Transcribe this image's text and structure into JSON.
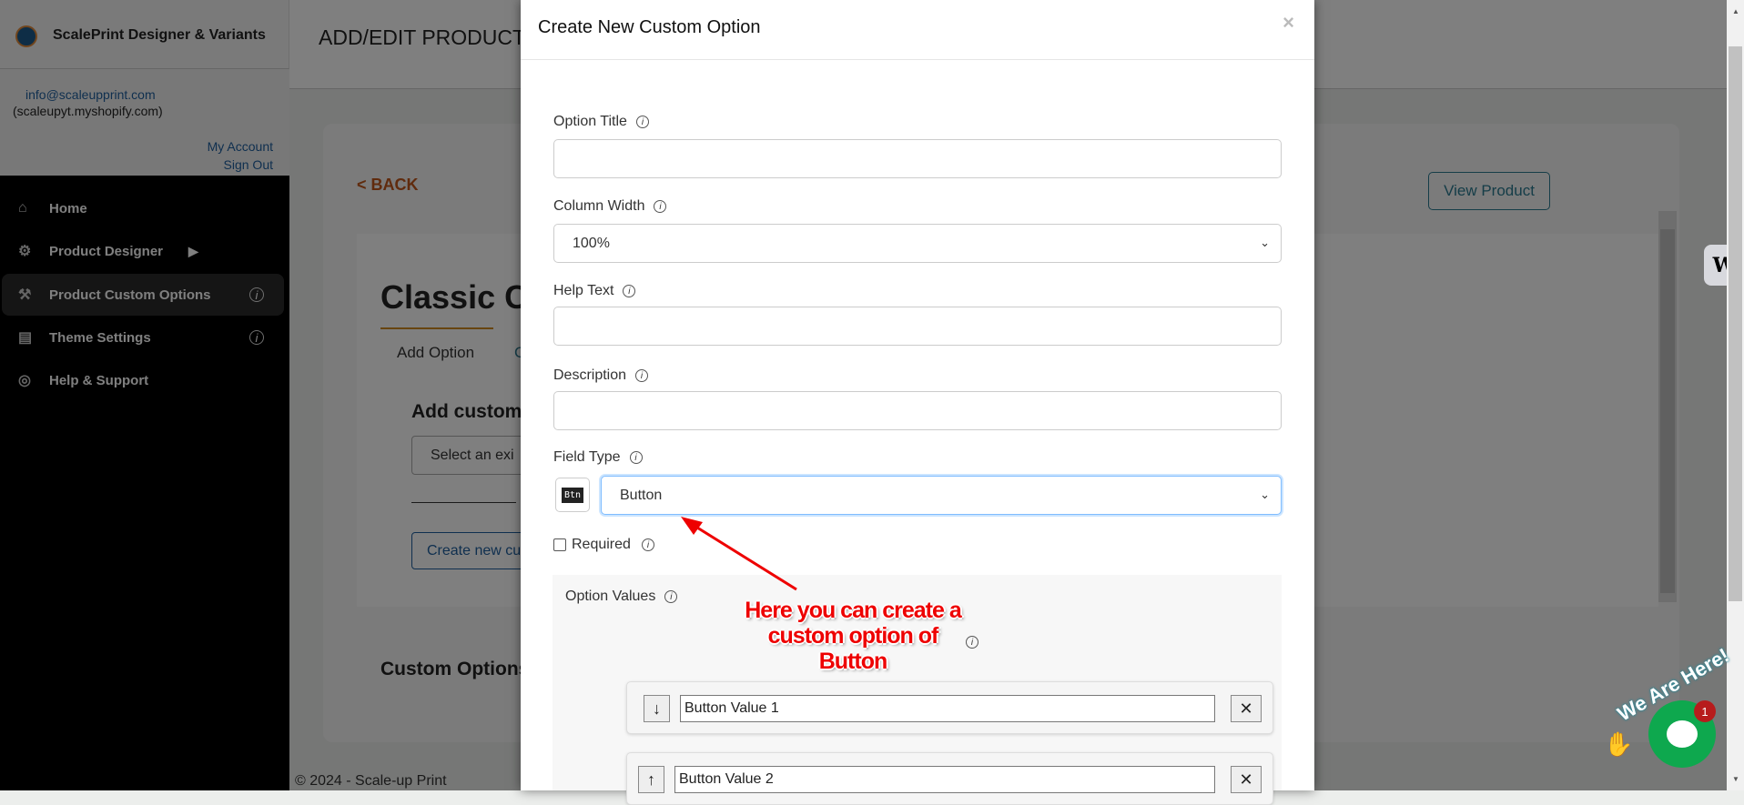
{
  "sidebar": {
    "brand": "ScalePrint Designer & Variants",
    "email": "info@scaleupprint.com",
    "shop": "(scaleupyt.myshopify.com)",
    "my_account": "My Account",
    "sign_out": "Sign Out",
    "items": [
      {
        "label": "Home",
        "icon": "home-icon"
      },
      {
        "label": "Product Designer",
        "icon": "network-icon"
      },
      {
        "label": "Product Custom Options",
        "icon": "tools-icon",
        "active": true
      },
      {
        "label": "Theme Settings",
        "icon": "layout-gear-icon"
      },
      {
        "label": "Help & Support",
        "icon": "lifebuoy-icon"
      }
    ]
  },
  "page": {
    "title": "ADD/EDIT PRODUCT C",
    "back": "< BACK",
    "view_product": "View Product",
    "product_title": "Classic C",
    "tab_add": "Add Option",
    "tab_other": "C",
    "add_custom": "Add custom",
    "select_existing": "Select an exi",
    "create_new": "Create new cu",
    "custom_options": "Custom Options",
    "footer": "© 2024 - Scale-up Print"
  },
  "modal": {
    "title": "Create New Custom Option",
    "close": "×",
    "option_title_label": "Option Title",
    "option_title_value": "",
    "column_width_label": "Column Width",
    "column_width_value": "100%",
    "help_text_label": "Help Text",
    "help_text_value": "",
    "description_label": "Description",
    "description_value": "",
    "field_type_label": "Field Type",
    "field_type_icon": "Btn",
    "field_type_value": "Button",
    "required_label": "Required",
    "required_checked": false,
    "option_values_label": "Option Values",
    "values": [
      {
        "value": "Button Value 1",
        "move": "↓",
        "remove": "✕"
      },
      {
        "value": "Button Value 2",
        "move": "↑",
        "remove": "✕"
      }
    ]
  },
  "annotation": {
    "line1": "Here you can create a",
    "line2": "custom option of",
    "line3": "Button",
    "color": "#e00000"
  },
  "widgets": {
    "w_badge": "W",
    "chat_caption": "We Are Here!",
    "chat_count": "1",
    "chat_color": "#0ea84e"
  }
}
